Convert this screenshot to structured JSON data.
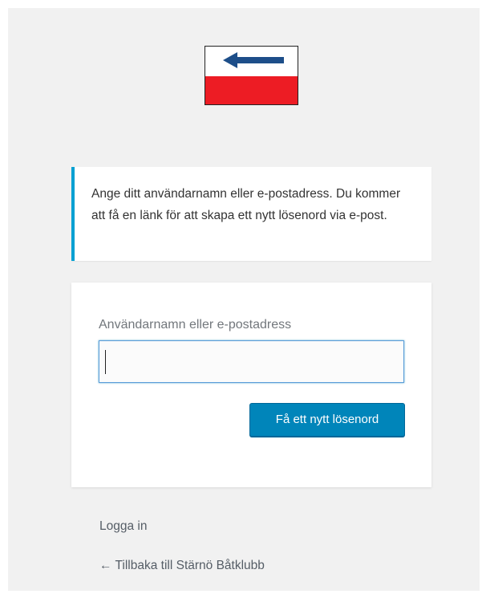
{
  "logo": {
    "icon": "left-arrow-flag-logo",
    "colors": {
      "top": "#ffffff",
      "bottom": "#ed1c24",
      "arrow": "#1d4e89"
    }
  },
  "message": {
    "text": "Ange ditt användarnamn eller e-postadress. Du kommer att få en länk för att skapa ett nytt lösenord via e-post.",
    "accent_color": "#00a0d2"
  },
  "form": {
    "username_label": "Användarnamn eller e-postadress",
    "username_value": "",
    "submit_label": "Få ett nytt lösenord",
    "button_color": "#0085ba"
  },
  "nav": {
    "login_label": "Logga in",
    "back_label": "← Tillbaka till Stärnö Båtklubb"
  }
}
